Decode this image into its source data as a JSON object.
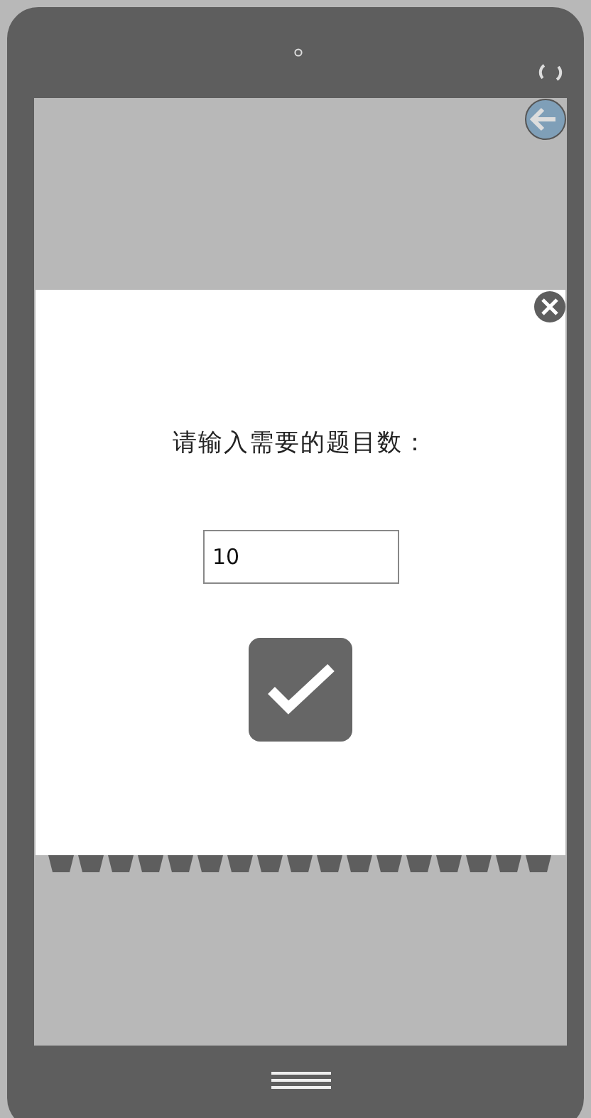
{
  "dialog": {
    "prompt": "请输入需要的题目数：",
    "input": {
      "value": "10"
    }
  }
}
